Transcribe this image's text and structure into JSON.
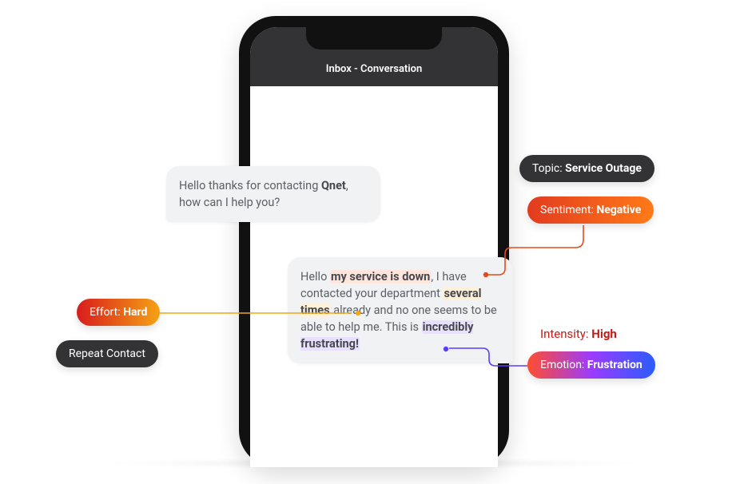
{
  "phone": {
    "header": "Inbox - Conversation"
  },
  "agent": {
    "pre": "Hello thanks for contacting ",
    "brand": "Qnet",
    "post": ", how can I help you?"
  },
  "customer": {
    "t1": "Hello ",
    "topic_span": "my service is down",
    "t2": ", I have contacted your department ",
    "times_span": "several times",
    "t3": " already and no one seems to be able to help me. This is ",
    "emotion_span": "incredibly frustrating!"
  },
  "annotations": {
    "topic_label": "Topic: ",
    "topic_value": "Service Outage",
    "sentiment_label": "Sentiment: ",
    "sentiment_value": "Negative",
    "effort_label": "Effort: ",
    "effort_value": "Hard",
    "repeat_contact": "Repeat Contact",
    "intensity_label": "Intensity: ",
    "intensity_value": "High",
    "emotion_label": "Emotion: ",
    "emotion_value": "Frustration"
  }
}
